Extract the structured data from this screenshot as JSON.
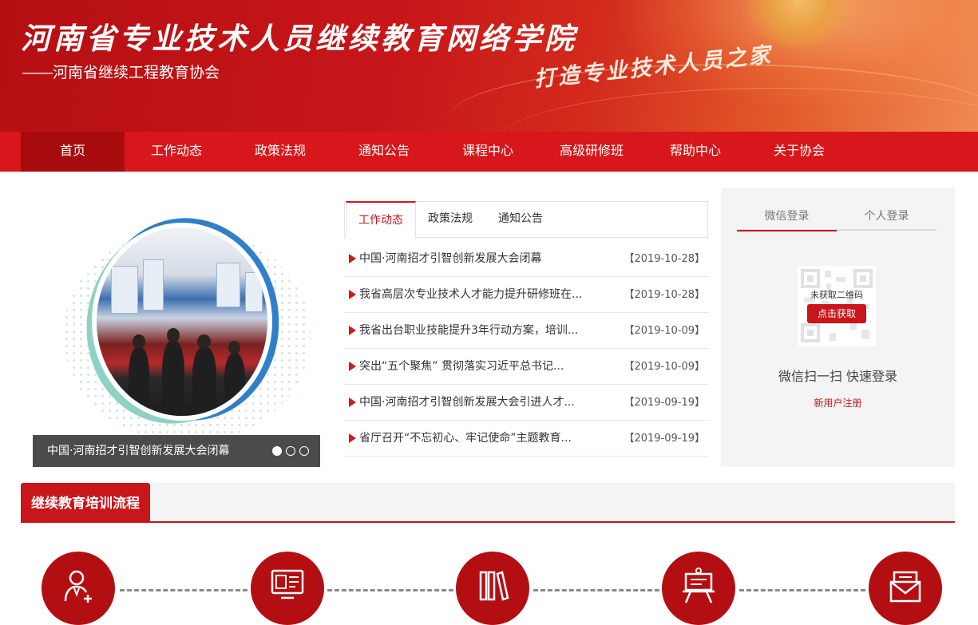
{
  "header": {
    "title": "河南省专业技术人员继续教育网络学院",
    "subtitle": "——河南省继续工程教育协会",
    "slogan": "打造专业技术人员之家"
  },
  "nav": {
    "items": [
      "首页",
      "工作动态",
      "政策法规",
      "通知公告",
      "课程中心",
      "高级研修班",
      "帮助中心",
      "关于协会"
    ],
    "active": "首页"
  },
  "slider": {
    "caption": "中国·河南招才引智创新发展大会闭幕",
    "slide_count": 3,
    "current_slide": 1
  },
  "news": {
    "tabs": [
      "工作动态",
      "政策法规",
      "通知公告"
    ],
    "active_tab": "工作动态",
    "items": [
      {
        "title": "中国·河南招才引智创新发展大会闭幕",
        "date": "【2019-10-28】"
      },
      {
        "title": "我省高层次专业技术人才能力提升研修班在...",
        "date": "【2019-10-28】"
      },
      {
        "title": "我省出台职业技能提升3年行动方案，培训...",
        "date": "【2019-10-09】"
      },
      {
        "title": "突出“五个聚焦” 贯彻落实习近平总书记...",
        "date": "【2019-10-09】"
      },
      {
        "title": "中国·河南招才引智创新发展大会引进人才...",
        "date": "【2019-09-19】"
      },
      {
        "title": "省厅召开“不忘初心、牢记使命”主题教育...",
        "date": "【2019-09-19】"
      }
    ]
  },
  "login": {
    "tabs": [
      "微信登录",
      "个人登录"
    ],
    "active_tab": "微信登录",
    "qr_status": "未获取二维码",
    "qr_button": "点击获取",
    "scan_text": "微信扫一扫 快速登录",
    "register": "新用户注册"
  },
  "process": {
    "title": "继续教育培训流程",
    "steps": [
      {
        "icon": "user-add-icon"
      },
      {
        "icon": "online-learning-icon"
      },
      {
        "icon": "books-icon"
      },
      {
        "icon": "presentation-board-icon"
      },
      {
        "icon": "certificate-envelope-icon"
      }
    ]
  },
  "colors": {
    "brand_red": "#d7171b",
    "dark_red": "#a70b0e",
    "accent_red": "#c8161b"
  }
}
